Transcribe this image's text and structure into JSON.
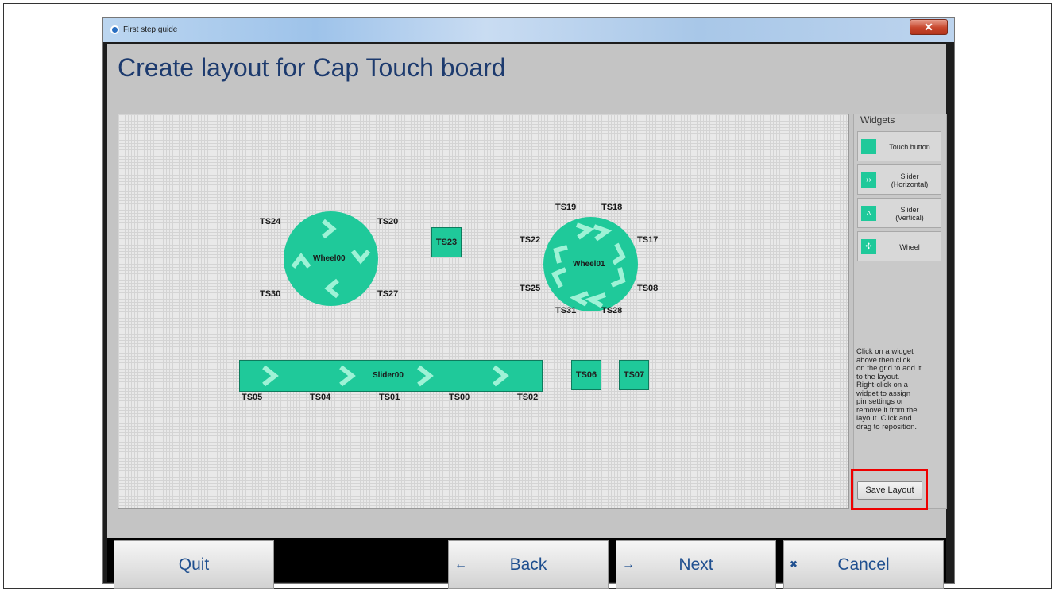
{
  "window": {
    "title": "First step guide",
    "close_label": "✕"
  },
  "page": {
    "title": "Create layout for Cap Touch board"
  },
  "widgets_panel": {
    "title": "Widgets",
    "items": [
      {
        "label": "Touch button",
        "icon": "touch-button-icon"
      },
      {
        "label": "Slider\n(Horizontal)",
        "icon": "horizontal-slider-icon"
      },
      {
        "label": "Slider\n(Vertical)",
        "icon": "vertical-slider-icon"
      },
      {
        "label": "Wheel",
        "icon": "wheel-icon"
      }
    ],
    "instructions": "Click on a widget\nabove then click\non the grid to add it\nto the layout.\nRight-click on a\nwidget to assign\npin settings or\nremove it from the\nlayout.  Click and\ndrag to reposition.",
    "save_label": "Save Layout"
  },
  "layout": {
    "wheel00": {
      "label": "Wheel00",
      "sensors": [
        "TS24",
        "TS20",
        "TS30",
        "TS27"
      ]
    },
    "wheel01": {
      "label": "Wheel01",
      "sensors": [
        "TS19",
        "TS18",
        "TS22",
        "TS17",
        "TS25",
        "TS08",
        "TS31",
        "TS28"
      ]
    },
    "buttons": [
      "TS23",
      "TS06",
      "TS07"
    ],
    "slider00": {
      "label": "Slider00",
      "sensors": [
        "TS05",
        "TS04",
        "TS01",
        "TS00",
        "TS02"
      ]
    }
  },
  "footer": {
    "quit": "Quit",
    "back": "Back",
    "next": "Next",
    "cancel": "Cancel",
    "back_icon": "←",
    "next_icon": "→",
    "cancel_icon": "✖"
  },
  "colors": {
    "widget": "#1fc99a",
    "title_text": "#1c3a6e",
    "highlight": "#ee0000"
  }
}
